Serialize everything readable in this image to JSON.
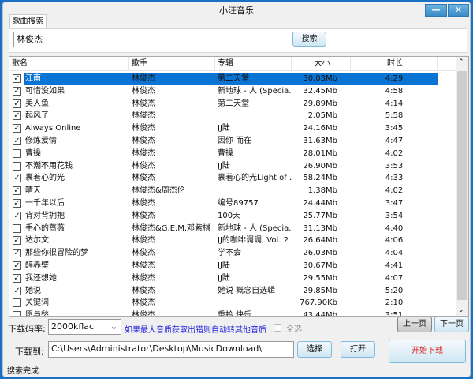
{
  "window": {
    "title": "小汪音乐",
    "minimize": "—",
    "close": "✕"
  },
  "tab": "歌曲搜索",
  "search": {
    "value": "林俊杰",
    "button": "搜索"
  },
  "columns": [
    "歌名",
    "歌手",
    "专辑",
    "大小",
    "时长"
  ],
  "rows": [
    {
      "checked": true,
      "name": "江南",
      "singer": "林俊杰",
      "album": "第二天堂",
      "size": "30.03Mb",
      "duration": "4:29",
      "selected": true
    },
    {
      "checked": true,
      "name": "可惜没如果",
      "singer": "林俊杰",
      "album": "新地球 - 人 (Specia...",
      "size": "32.45Mb",
      "duration": "4:58"
    },
    {
      "checked": true,
      "name": "美人鱼",
      "singer": "林俊杰",
      "album": "第二天堂",
      "size": "29.89Mb",
      "duration": "4:14"
    },
    {
      "checked": true,
      "name": "起风了",
      "singer": "林俊杰",
      "album": "",
      "size": "2.05Mb",
      "duration": "5:58"
    },
    {
      "checked": true,
      "name": "Always Online",
      "singer": "林俊杰",
      "album": "JJ陆",
      "size": "24.16Mb",
      "duration": "3:45"
    },
    {
      "checked": true,
      "name": "修炼爱情",
      "singer": "林俊杰",
      "album": "因你 而在",
      "size": "31.63Mb",
      "duration": "4:47"
    },
    {
      "checked": false,
      "name": "曹操",
      "singer": "林俊杰",
      "album": "曹操",
      "size": "28.01Mb",
      "duration": "4:02"
    },
    {
      "checked": false,
      "name": "不潮不用花钱",
      "singer": "林俊杰",
      "album": "JJ陆",
      "size": "26.90Mb",
      "duration": "3:53"
    },
    {
      "checked": true,
      "name": "裹着心的光",
      "singer": "林俊杰",
      "album": "裹着心的光Light of ...",
      "size": "58.24Mb",
      "duration": "4:33"
    },
    {
      "checked": true,
      "name": "晴天",
      "singer": "林俊杰&周杰伦",
      "album": "",
      "size": "1.38Mb",
      "duration": "4:02"
    },
    {
      "checked": true,
      "name": "一千年以后",
      "singer": "林俊杰",
      "album": "编号89757",
      "size": "24.44Mb",
      "duration": "3:47"
    },
    {
      "checked": true,
      "name": "背对背拥抱",
      "singer": "林俊杰",
      "album": "100天",
      "size": "25.77Mb",
      "duration": "3:54"
    },
    {
      "checked": false,
      "name": "手心的蔷薇",
      "singer": "林俊杰&G.E.M.邓紫棋",
      "album": "新地球 - 人 (Specia...",
      "size": "31.13Mb",
      "duration": "4:40"
    },
    {
      "checked": true,
      "name": "达尔文",
      "singer": "林俊杰",
      "album": "JJ的咖啡调调, Vol. 2",
      "size": "26.64Mb",
      "duration": "4:06"
    },
    {
      "checked": true,
      "name": "那些你很冒险的梦",
      "singer": "林俊杰",
      "album": "学不会",
      "size": "26.03Mb",
      "duration": "4:04"
    },
    {
      "checked": true,
      "name": "醉赤壁",
      "singer": "林俊杰",
      "album": "JJ陆",
      "size": "30.67Mb",
      "duration": "4:41"
    },
    {
      "checked": true,
      "name": "我还想她",
      "singer": "林俊杰",
      "album": "JJ陆",
      "size": "29.55Mb",
      "duration": "4:07"
    },
    {
      "checked": true,
      "name": "她说",
      "singer": "林俊杰",
      "album": "她说 概念自选辑",
      "size": "29.85Mb",
      "duration": "5:20"
    },
    {
      "checked": false,
      "name": "关键词",
      "singer": "林俊杰",
      "album": "",
      "size": "767.90Kb",
      "duration": "2:10"
    },
    {
      "checked": false,
      "name": "愿与愁",
      "singer": "林俊杰",
      "album": "重拾 快乐",
      "size": "43.44Mb",
      "duration": "3:51"
    }
  ],
  "bottom": {
    "bitrate_label": "下载码率:",
    "bitrate_value": "2000kflac",
    "hint": "如果最大音质获取出错则自动转其他音质",
    "select_all": "全选",
    "prev_page": "上一页",
    "next_page": "下一页",
    "save_label": "下载到:",
    "save_path": "C:\\Users\\Administrator\\Desktop\\MusicDownload\\",
    "choose": "选择",
    "open": "打开",
    "start": "开始下载",
    "status": "搜索完成"
  },
  "colors": {
    "selection": "#0a74d4",
    "hint": "#1a1adf",
    "start": "#e02020"
  }
}
